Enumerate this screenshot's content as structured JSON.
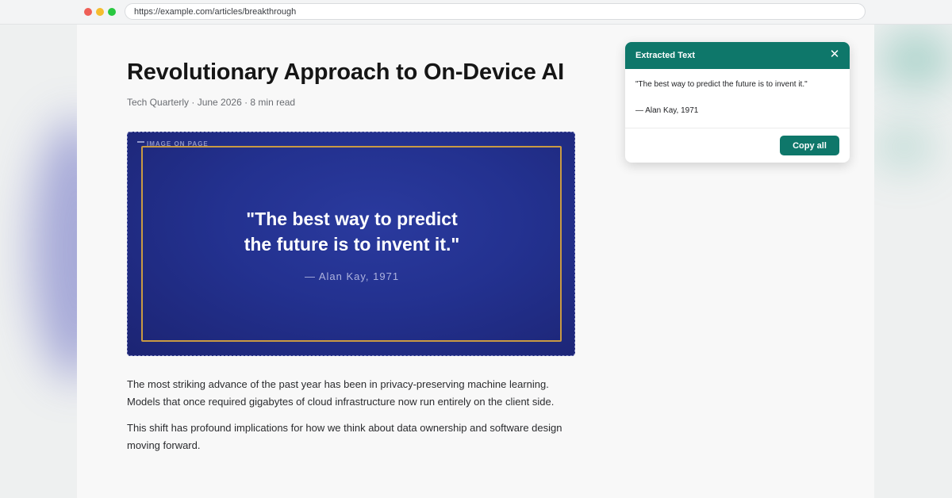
{
  "browser": {
    "url": "https://example.com/articles/breakthrough"
  },
  "article": {
    "title": "Revolutionary Approach to On-Device AI",
    "meta": "Tech Quarterly · June 2026 · 8 min read",
    "image": {
      "tag": "IMAGE ON PAGE",
      "quote_line1": "\"The best way to predict",
      "quote_line2": "the future is to invent it.\"",
      "author": "— Alan Kay, 1971"
    },
    "paragraphs": [
      "The most striking advance of the past year has been in privacy-preserving machine learning. Models that once required gigabytes of cloud infrastructure now run entirely on the client side.",
      "This shift has profound implications for how we think about data ownership and software design moving forward."
    ]
  },
  "popup": {
    "title": "Extracted Text",
    "close_glyph": "✕",
    "lines": [
      "\"The best way to predict the future is to invent it.\"",
      "— Alan Kay, 1971"
    ],
    "copy_label": "Copy all"
  },
  "colors": {
    "accent": "#0e776a",
    "image_bg": "#23318f",
    "frame_gold": "#c99a43"
  }
}
